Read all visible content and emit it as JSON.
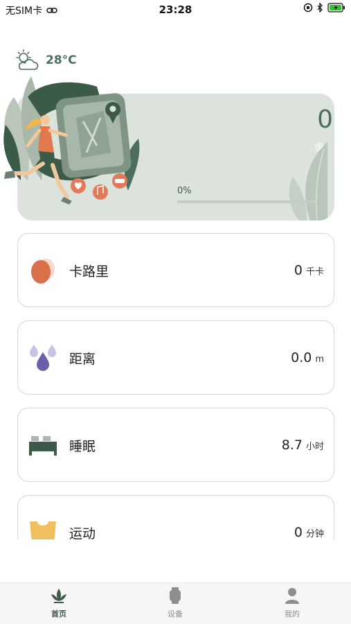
{
  "status_bar": {
    "carrier": "无SIM卡",
    "time": "23:28"
  },
  "weather": {
    "icon": "sun-cloud-icon",
    "temperature": "28°C"
  },
  "steps": {
    "value": "0",
    "unit": "步",
    "progress_label": "0%",
    "progress_fraction": 0
  },
  "stats": [
    {
      "icon": "egg-icon",
      "label": "卡路里",
      "value": "0",
      "unit": "千卡"
    },
    {
      "icon": "water-drop-icon",
      "label": "距离",
      "value": "0.0",
      "unit": "m"
    },
    {
      "icon": "bed-icon",
      "label": "睡眠",
      "value": "8.7",
      "unit": "小时"
    },
    {
      "icon": "basket-icon",
      "label": "运动",
      "value": "0",
      "unit": "分钟"
    }
  ],
  "tabs": [
    {
      "label": "首页",
      "icon": "leaf-icon",
      "active": true
    },
    {
      "label": "设备",
      "icon": "watch-icon",
      "active": false
    },
    {
      "label": "我的",
      "icon": "person-icon",
      "active": false
    }
  ],
  "colors": {
    "accent": "#4c6e5c",
    "card_bg": "#dce2dc",
    "calorie": "#d9704a",
    "distance": "#6a5fa8",
    "sleep": "#3c5a48",
    "sport": "#f0c060"
  }
}
